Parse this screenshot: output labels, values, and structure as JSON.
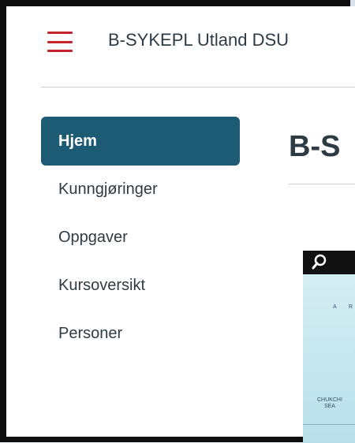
{
  "header": {
    "course_title": "B-SYKEPL Utland DSU"
  },
  "sidebar": {
    "items": [
      {
        "label": "Hjem",
        "active": true
      },
      {
        "label": "Kunngjøringer",
        "active": false
      },
      {
        "label": "Oppgaver",
        "active": false
      },
      {
        "label": "Kursoversikt",
        "active": false
      },
      {
        "label": "Personer",
        "active": false
      }
    ]
  },
  "main": {
    "heading": "B-S"
  },
  "map": {
    "labels": {
      "a": "A",
      "r": "R",
      "sea": "CHUKCHI\nSEA"
    }
  },
  "colors": {
    "accent": "#1d5a74",
    "hamburger": "#c3252c",
    "text": "#2d3b45"
  }
}
